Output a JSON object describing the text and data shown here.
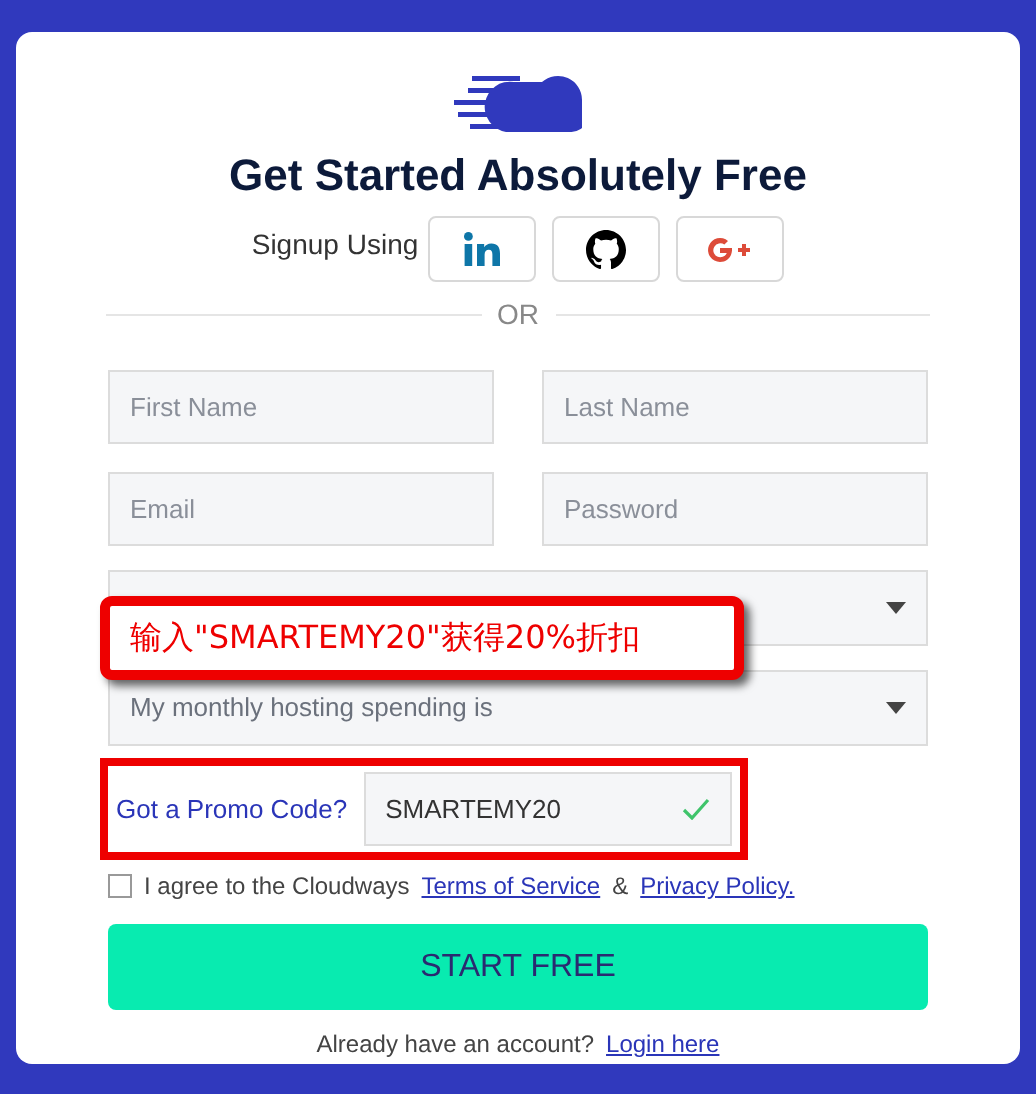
{
  "title": "Get Started Absolutely Free",
  "social": {
    "label": "Signup Using",
    "buttons": [
      {
        "kind": "linkedin"
      },
      {
        "kind": "github"
      },
      {
        "kind": "google"
      }
    ]
  },
  "divider": "OR",
  "fields": [
    {
      "placeholder": "First Name"
    },
    {
      "placeholder": "Last Name"
    },
    {
      "placeholder": "Email"
    },
    {
      "placeholder": "Password"
    }
  ],
  "selects": [
    {
      "kind": "select"
    },
    {
      "kind": "select",
      "value": "My monthly hosting spending is"
    }
  ],
  "callout": "输入\"SMARTEMY20\"获得20%折扣",
  "promo": {
    "label": "Got a Promo Code?",
    "value": "SMARTEMY20",
    "valid": true
  },
  "agree": {
    "checked": false,
    "text": "I agree to the Cloudways",
    "terms": "Terms of Service",
    "amp": "&",
    "privacy": "Privacy Policy."
  },
  "submit": "START FREE",
  "login": {
    "text": "Already have an account?",
    "link": "Login here"
  }
}
